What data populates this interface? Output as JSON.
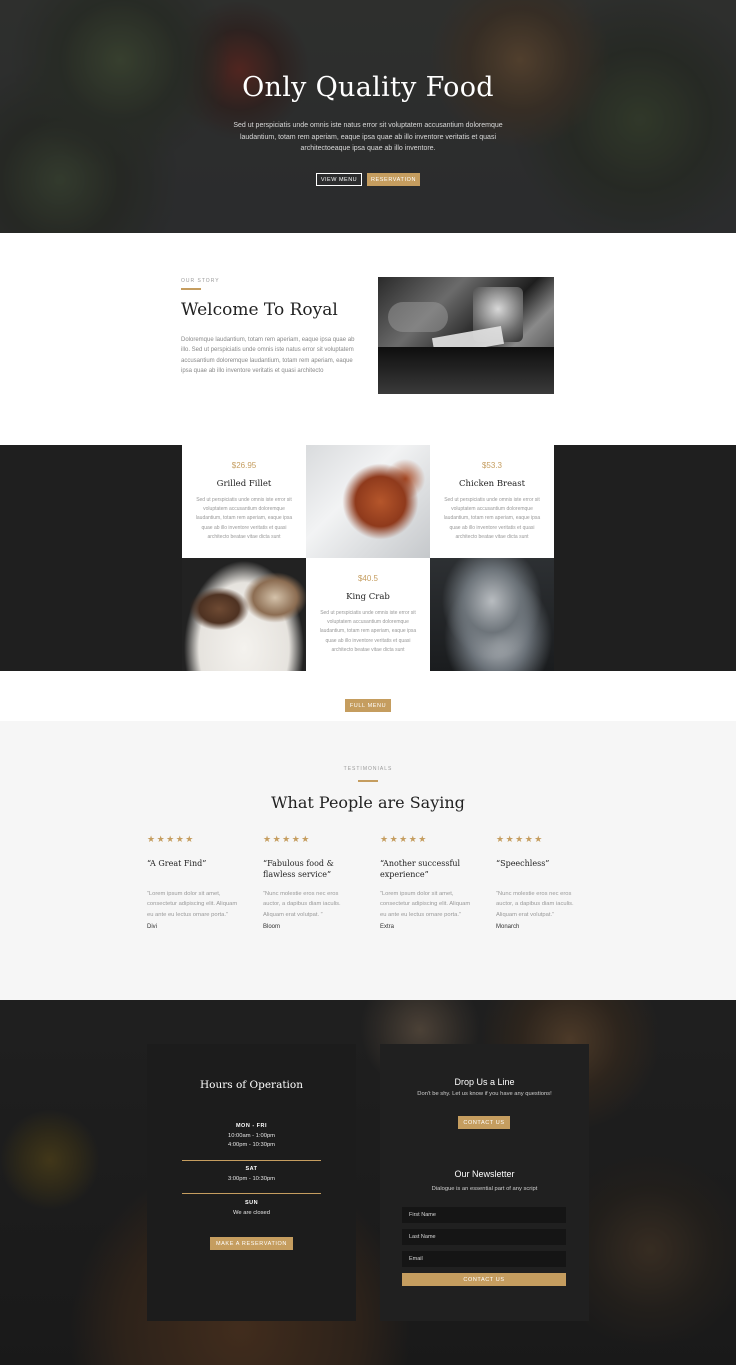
{
  "hero": {
    "title": "Only Quality Food",
    "text": "Sed ut perspiciatis unde omnis iste natus error sit voluptatem accusantium doloremque laudantium, totam rem aperiam, eaque ipsa quae ab illo inventore veritatis et quasi architectoeaque ipsa quae ab illo inventore.",
    "view_menu": "VIEW MENU",
    "reservation": "RESERVATION"
  },
  "story": {
    "eyebrow": "OUR STORY",
    "title": "Welcome To Royal",
    "text": "Doloremque laudantium, totam rem aperiam, eaque ipsa quae ab illo. Sed ut perspiciatis unde omnis iste natus error sit voluptatem accusantium doloremque laudantium, totam rem aperiam, eaque ipsa quae ab illo inventore veritatis et quasi architecto"
  },
  "menu": {
    "items": [
      {
        "price": "$26.95",
        "name": "Grilled Fillet",
        "desc": "Sed ut perspiciatis unde omnis iste error sit voluptatem accusantium doloremque laudantium, totam rem aperiam, eaque ipsa quae ab illo inventore veritatis et quasi architecto beatae vitae dicta sunt"
      },
      {
        "price": "$53.3",
        "name": "Chicken Breast",
        "desc": "Sed ut perspiciatis unde omnis iste error sit voluptatem accusantium doloremque laudantium, totam rem aperiam, eaque ipsa quae ab illo inventore veritatis et quasi architecto beatae vitae dicta sunt"
      },
      {
        "price": "$40.5",
        "name": "King Crab",
        "desc": "Sed ut perspiciatis unde omnis iste error sit voluptatem accusantium doloremque laudantium, totam rem aperiam, eaque ipsa quae ab illo inventore veritatis et quasi architecto beatae vitae dicta sunt"
      }
    ],
    "full_menu": "FULL MENU"
  },
  "testimonials": {
    "eyebrow": "TESTIMONIALS",
    "title": "What People are Saying",
    "items": [
      {
        "stars": "★★★★★",
        "quote": "“A Great Find”",
        "text": "“Lorem ipsum dolor sit amet, consectetur adipiscing elit. Aliquam eu ante eu lectus ornare porta.”",
        "author": "Divi"
      },
      {
        "stars": "★★★★★",
        "quote": "“Fabulous food & flawless service”",
        "text": "“Nunc molestie eros nec eros auctor, a dapibus diam iaculis. Aliquam erat volutpat. ”",
        "author": "Bloom"
      },
      {
        "stars": "★★★★★",
        "quote": "“Another successful experience”",
        "text": "“Lorem ipsum dolor sit amet, consectetur adipiscing elit. Aliquam eu ante eu lectus ornare porta.”",
        "author": "Extra"
      },
      {
        "stars": "★★★★★",
        "quote": "“Speechless”",
        "text": "“Nunc molestie eros nec eros auctor, a dapibus diam iaculis. Aliquam erat volutpat.”",
        "author": "Monarch"
      }
    ]
  },
  "hours": {
    "title": "Hours of Operation",
    "mon_fri_label": "MON - FRI",
    "mon_fri_1": "10:00am - 1:00pm",
    "mon_fri_2": "4:00pm - 10:30pm",
    "sat_label": "SAT",
    "sat_1": "3:00pm - 10:30pm",
    "sun_label": "SUN",
    "sun_1": "We are closed",
    "button": "MAKE A RESERVATION"
  },
  "contact": {
    "title": "Drop Us a Line",
    "sub": "Don't be shy. Let us know if you have any questions!",
    "button": "CONTACT US",
    "newsletter_title": "Our Newsletter",
    "newsletter_sub": "Dialogue is an essential part of any script",
    "first_name": "First Name",
    "last_name": "Last Name",
    "email": "Email",
    "submit": "CONTACT US"
  },
  "colors": {
    "accent": "#c59d5f",
    "dark": "#1f1f1f",
    "light_bg": "#f6f6f6"
  }
}
